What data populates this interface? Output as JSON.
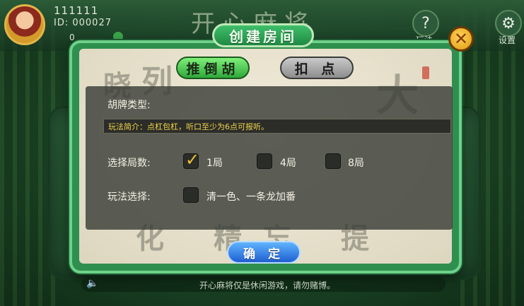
{
  "player": {
    "name": "111111",
    "id_label": "ID: 000027",
    "coins": "0"
  },
  "topbar": {
    "title": "开心麻将",
    "help_label": "玩法",
    "settings_label": "设置"
  },
  "dialog": {
    "title": "创建房间",
    "tabs": [
      {
        "label": "推倒胡",
        "active": true
      },
      {
        "label": "扣 点",
        "active": false
      }
    ],
    "hu_type_label": "胡牌类型:",
    "rule_intro": "玩法简介：点杠包杠，听口至少为6点可报听。",
    "rounds_label": "选择局数:",
    "rounds_options": [
      {
        "label": "1局",
        "checked": true
      },
      {
        "label": "4局",
        "checked": false
      },
      {
        "label": "8局",
        "checked": false
      }
    ],
    "play_label": "玩法选择:",
    "play_options": [
      {
        "label": "清一色、一条龙加番",
        "checked": false
      }
    ],
    "confirm_label": "确 定"
  },
  "marquee": {
    "text": "开心麻将仅是休闲游戏，请勿赌博。"
  },
  "colors": {
    "accent_green": "#2f8f4f",
    "check_yellow": "#f2c12a",
    "rule_text": "#f0d44a",
    "confirm_blue": "#1f5fd0"
  },
  "icons": {
    "help": "question-icon",
    "settings": "gear-icon",
    "close": "close-icon",
    "speaker": "speaker-icon"
  }
}
